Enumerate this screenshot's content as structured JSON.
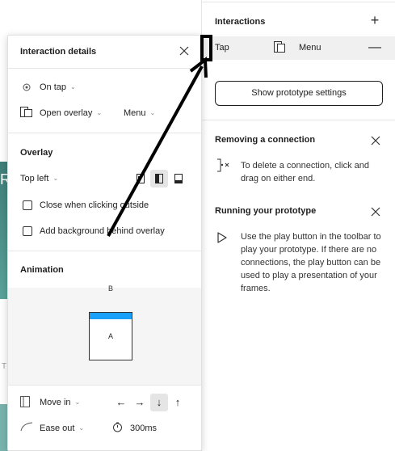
{
  "canvas": {
    "letter": "R",
    "bottom_letter": "T"
  },
  "interactions_panel": {
    "title": "Interactions",
    "row": {
      "trigger": "Tap",
      "destination": "Menu"
    },
    "show_settings_button": "Show prototype settings",
    "tips": [
      {
        "title": "Removing a connection",
        "text": "To delete a connection, click and drag on either end."
      },
      {
        "title": "Running your prototype",
        "text": "Use the play button in the toolbar to play your prototype. If there are no connections, the play button can be used to play a presentation of your frames."
      }
    ]
  },
  "interaction_details": {
    "title": "Interaction details",
    "trigger": "On tap",
    "action": "Open overlay",
    "destination": "Menu",
    "overlay": {
      "title": "Overlay",
      "position": "Top left",
      "close_outside_label": "Close when clicking outside",
      "close_outside_checked": false,
      "add_background_label": "Add background behind overlay",
      "add_background_checked": false
    },
    "animation": {
      "title": "Animation",
      "preview_from": "B",
      "preview_to": "A",
      "transition": "Move in",
      "direction_selected": "down",
      "easing": "Ease out",
      "duration": "300ms"
    }
  },
  "colors": {
    "accent": "#18a0fb",
    "annotation": "#000000"
  }
}
